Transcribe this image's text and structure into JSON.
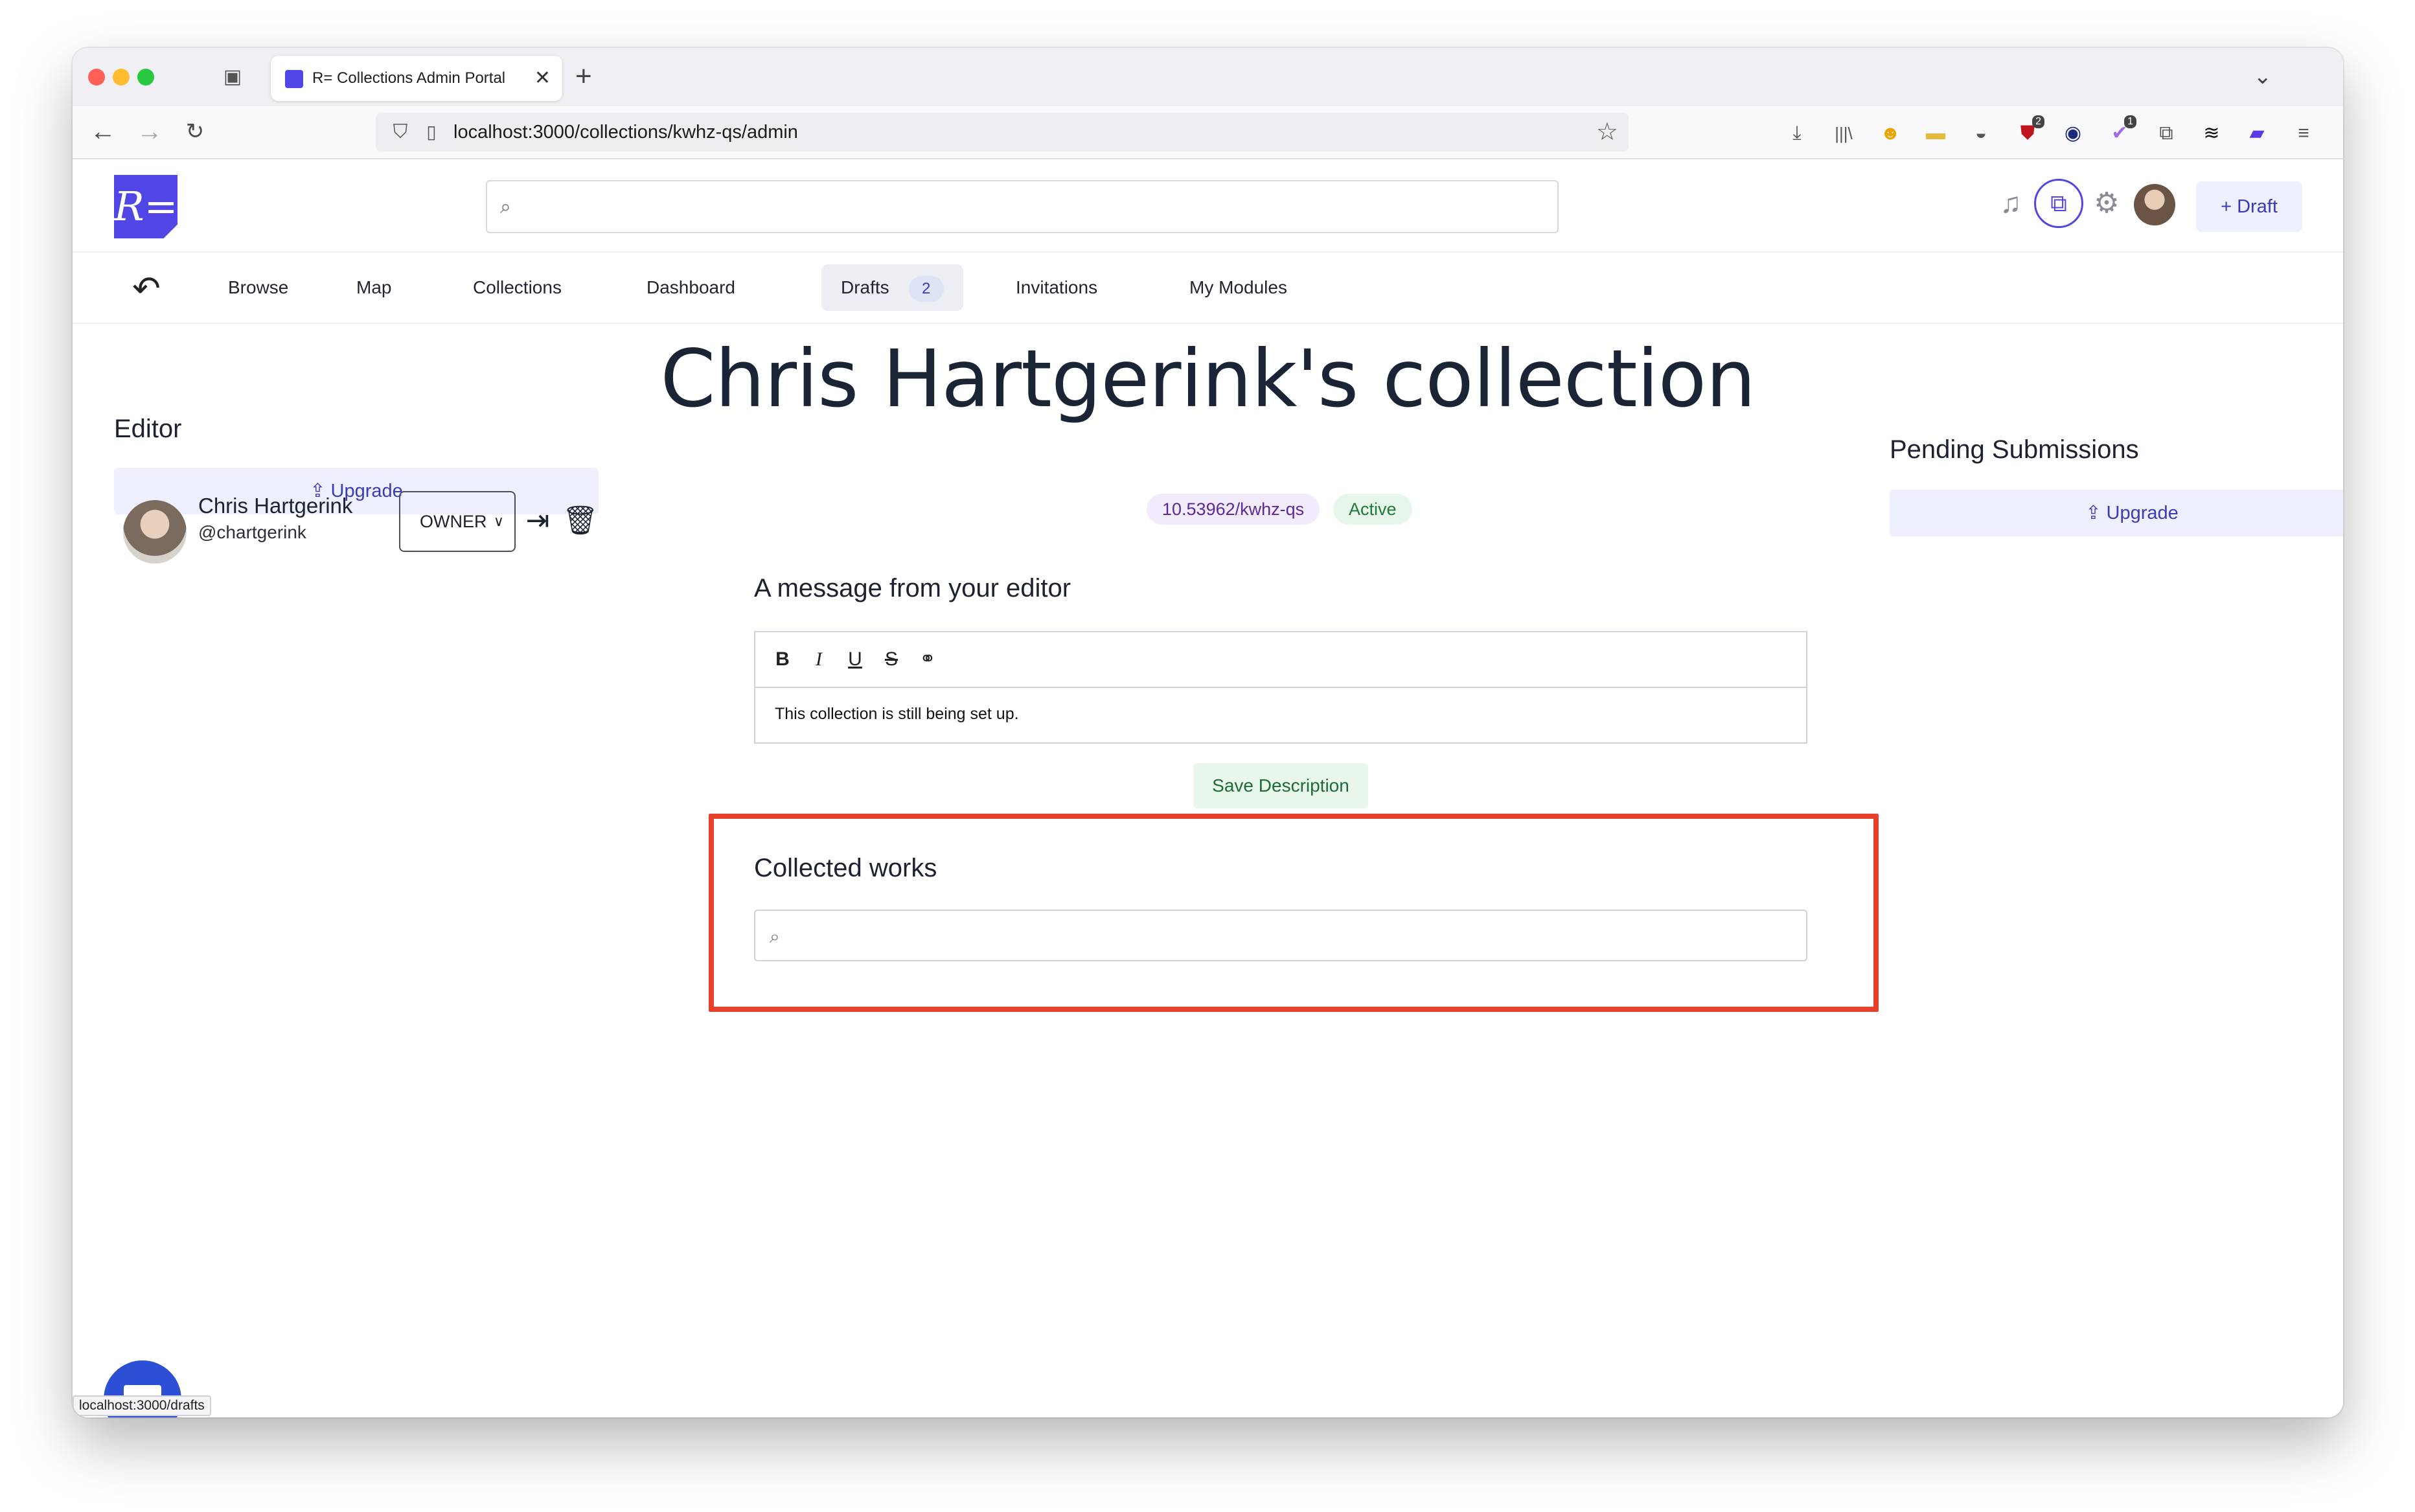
{
  "browser": {
    "tab_title": "R= Collections Admin Portal",
    "tab_close": "✕",
    "new_tab": "+",
    "tab_list": "⌄",
    "url": "localhost:3000/collections/kwhz-qs/admin",
    "ext_badge_1": "2",
    "ext_badge_2": "1",
    "status_url": "localhost:3000/drafts"
  },
  "header": {
    "logo_text": "R=",
    "search_value": "",
    "draft_label": "+ Draft"
  },
  "nav": {
    "items": [
      "Browse",
      "Map",
      "Collections",
      "Dashboard",
      "Drafts",
      "Invitations",
      "My Modules"
    ],
    "drafts_count": "2"
  },
  "editor": {
    "heading": "Editor",
    "upgrade_label": "⇪ Upgrade",
    "name": "Chris Hartgerink",
    "handle": "@chartgerink",
    "role": "OWNER"
  },
  "collection": {
    "title": "Chris Hartgerink's collection",
    "doi": "10.53962/kwhz-qs",
    "status": "Active",
    "message_heading": "A message from your editor",
    "message_body": "This collection is still being set up.",
    "save_label": "Save Description",
    "works_heading": "Collected works",
    "works_search_value": ""
  },
  "pending": {
    "heading": "Pending Submissions",
    "upgrade_label": "⇪ Upgrade"
  },
  "colors": {
    "accent": "#4f46e5",
    "highlight": "#e5412d",
    "active_green": "#1f7a3a"
  },
  "icons": [
    "back-icon",
    "forward-icon",
    "reload-icon",
    "shield-icon",
    "bookmark-star-icon",
    "download-icon",
    "library-icon",
    "bell-icon",
    "collections-icon",
    "gear-icon",
    "undo-icon",
    "leave-icon",
    "trash-icon",
    "bold-icon",
    "italic-icon",
    "underline-icon",
    "strikethrough-icon",
    "link-icon",
    "search-icon",
    "chat-icon"
  ]
}
